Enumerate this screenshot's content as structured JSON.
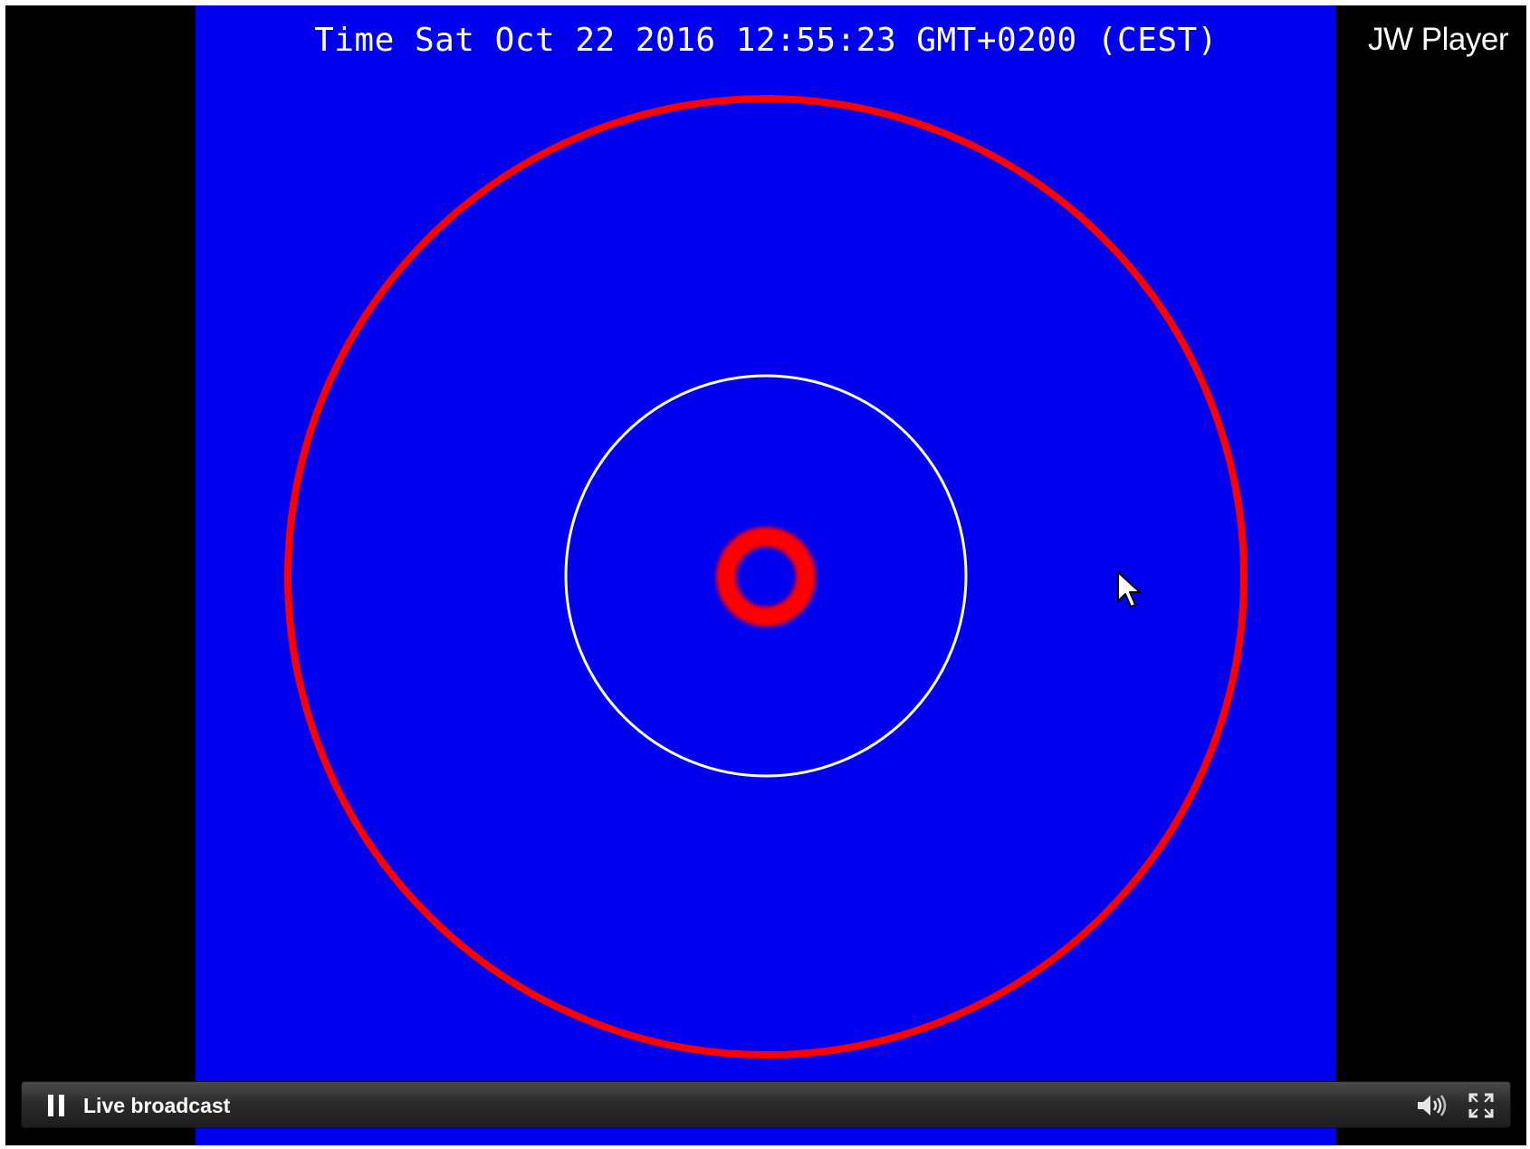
{
  "player": {
    "timestamp": "Time Sat Oct 22 2016 12:55:23 GMT+0200 (CEST)",
    "watermark": "JW Player",
    "status_label": "Live broadcast",
    "colors": {
      "video_background": "#0000ee",
      "ring_red": "#ff0000",
      "ring_white": "#ffffff"
    }
  },
  "controls": {
    "play_pause_icon": "pause-icon",
    "volume_icon": "volume-icon",
    "fullscreen_icon": "fullscreen-icon"
  }
}
